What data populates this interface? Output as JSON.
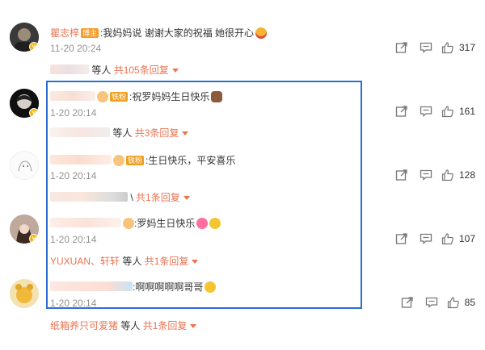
{
  "comments": [
    {
      "user": "瞿志梓",
      "badge": "博主",
      "text": ":我妈妈说 谢谢大家的祝福 她很开心",
      "time": "11-20 20:24",
      "replies_prefix": "等人",
      "replies_count": "共105条回复",
      "likes": "317"
    },
    {
      "badge": "铁粉",
      "text": ":祝罗妈妈生日快乐",
      "time": "1-20 20:14",
      "replies_prefix": "等人",
      "replies_count": "共3条回复",
      "likes": "161"
    },
    {
      "badge": "铁粉",
      "text": ":生日快乐，平安喜乐",
      "time": "1-20 20:14",
      "replies_prefix": "\\",
      "replies_count": "共1条回复",
      "likes": "128"
    },
    {
      "text": ":罗妈生日快乐",
      "time": "1-20 20:14",
      "replies_users": "YUXUAN、轩轩",
      "replies_prefix": "等人",
      "replies_count": "共1条回复",
      "likes": "107"
    },
    {
      "text": ":啊啊啊啊啊哥哥",
      "time": "1-20 20:14",
      "replies_users": "纸箱养只可爱猪",
      "replies_prefix": "等人",
      "replies_count": "共1条回复",
      "likes": "85"
    }
  ],
  "icons": {
    "share": "share-icon",
    "comment": "comment-icon",
    "like": "like-icon",
    "verified": "verified-badge-icon"
  },
  "colors": {
    "username": "#eb7350",
    "highlight": "#2b6fd1",
    "badge": "#f59b28",
    "verified": "#f7b500"
  }
}
